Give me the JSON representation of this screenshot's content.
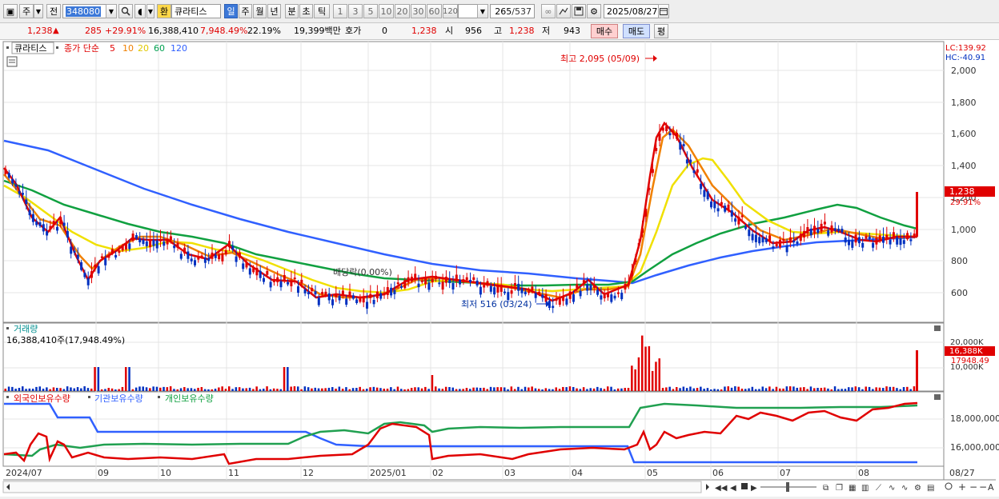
{
  "toolbar": {
    "period_select": "주",
    "prev_label": "전",
    "code_value": "348080",
    "fx_label": "환",
    "stock_name": "큐라티스",
    "period_tabs": [
      "일",
      "주",
      "월",
      "년",
      "분",
      "초",
      "틱"
    ],
    "interval_buttons": [
      "1",
      "3",
      "5",
      "10",
      "20",
      "30",
      "60",
      "120"
    ],
    "count_value": "265",
    "count_total": "/537",
    "date_value": "2025/08/27"
  },
  "quote": {
    "price": "1,238",
    "change": "285",
    "change_rate": "+29.91%",
    "volume": "16,388,410",
    "volume_rate": "7,948.49%",
    "turnover": "22.19%",
    "amount": "19,399백만",
    "hoga_label": "호가",
    "hoga_value": "0",
    "hoga_price": "1,238",
    "open_label": "시",
    "open_value": "956",
    "high_label": "고",
    "high_value": "1,238",
    "low_label": "저",
    "low_value": "943",
    "buy_label": "매수",
    "sell_label": "매도",
    "eval_label": "평"
  },
  "legend": {
    "name": "큐라티스",
    "ma_label": "종가 단순",
    "ma_periods": [
      "5",
      "10",
      "20",
      "60",
      "120"
    ],
    "ma_colors": [
      "#e00000",
      "#f08000",
      "#f0e000",
      "#00a050",
      "#3060ff"
    ]
  },
  "annotations": {
    "high": "최고 2,095 (05/09)",
    "low": "최저 516 (03/24)",
    "dividend": "배당락(0.00%)"
  },
  "axis_info": {
    "lc": "LC:139.92",
    "hc": "HC:-40.91",
    "price_ticks": [
      "2,000",
      "1,800",
      "1,600",
      "1,400",
      "1,200",
      "1,000",
      "800",
      "600"
    ],
    "last_price_tag": "1,238",
    "last_rate_tag": "29.91%"
  },
  "volume_panel": {
    "title": "거래량",
    "info": "16,388,410주(17,948.49%)",
    "ticks": [
      "20,000K",
      "10,000K"
    ],
    "last_tag": "16,388K",
    "last_rate_tag": "17948.49"
  },
  "holdings_panel": {
    "series": [
      "외국인보유수량",
      "기관보유수량",
      "개인보유수량"
    ],
    "ticks": [
      "18,000,000",
      "16,000,000"
    ]
  },
  "x_labels": [
    "2024/07",
    "09",
    "10",
    "11",
    "12",
    "2025/01",
    "02",
    "03",
    "04",
    "05",
    "06",
    "07",
    "08",
    "08/27"
  ],
  "chart_data": {
    "type": "candlestick",
    "y_range": [
      500,
      2200
    ],
    "price_ticks": [
      2000,
      1800,
      1600,
      1400,
      1200,
      1000,
      800,
      600
    ],
    "high": {
      "value": 2095,
      "date": "05/09"
    },
    "low": {
      "value": 516,
      "date": "03/24"
    },
    "last_close": 1238,
    "ma_periods": [
      5,
      10,
      20,
      60,
      120
    ]
  }
}
